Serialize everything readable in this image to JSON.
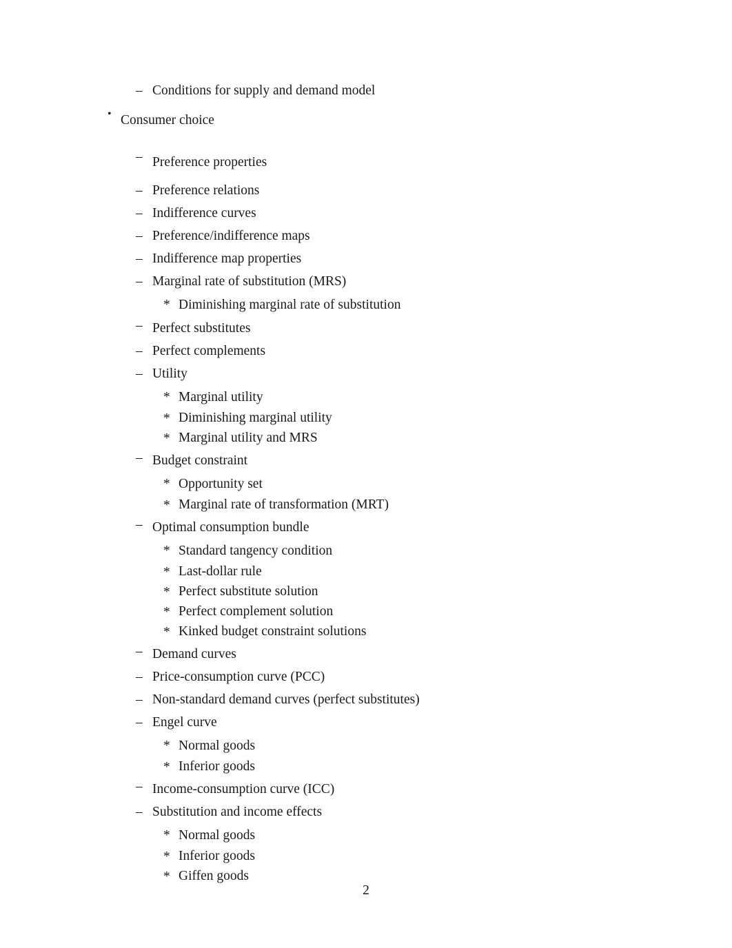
{
  "document": {
    "page_number": "2",
    "markers": {
      "level1": "•",
      "level2": "–",
      "level3": "*"
    }
  },
  "outline": [
    {
      "level": 2,
      "text": "Conditions for supply and demand model"
    },
    {
      "level": 1,
      "text": "Consumer choice"
    },
    {
      "level": 2,
      "text": "Preference properties"
    },
    {
      "level": 2,
      "text": "Preference relations"
    },
    {
      "level": 2,
      "text": "Indifference curves"
    },
    {
      "level": 2,
      "text": "Preference/indifference maps"
    },
    {
      "level": 2,
      "text": "Indifference map properties"
    },
    {
      "level": 2,
      "text": "Marginal rate of substitution (MRS)"
    },
    {
      "level": 3,
      "text": "Diminishing marginal rate of substitution"
    },
    {
      "level": 2,
      "text": "Perfect substitutes"
    },
    {
      "level": 2,
      "text": "Perfect complements"
    },
    {
      "level": 2,
      "text": "Utility"
    },
    {
      "level": 3,
      "text": "Marginal utility"
    },
    {
      "level": 3,
      "text": "Diminishing marginal utility"
    },
    {
      "level": 3,
      "text": "Marginal utility and MRS"
    },
    {
      "level": 2,
      "text": "Budget constraint"
    },
    {
      "level": 3,
      "text": "Opportunity set"
    },
    {
      "level": 3,
      "text": "Marginal rate of transformation (MRT)"
    },
    {
      "level": 2,
      "text": "Optimal consumption bundle"
    },
    {
      "level": 3,
      "text": "Standard tangency condition"
    },
    {
      "level": 3,
      "text": "Last-dollar rule"
    },
    {
      "level": 3,
      "text": "Perfect substitute solution"
    },
    {
      "level": 3,
      "text": "Perfect complement solution"
    },
    {
      "level": 3,
      "text": "Kinked budget constraint solutions"
    },
    {
      "level": 2,
      "text": "Demand curves"
    },
    {
      "level": 2,
      "text": "Price-consumption curve (PCC)"
    },
    {
      "level": 2,
      "text": "Non-standard demand curves (perfect substitutes)"
    },
    {
      "level": 2,
      "text": "Engel curve"
    },
    {
      "level": 3,
      "text": "Normal goods"
    },
    {
      "level": 3,
      "text": "Inferior goods"
    },
    {
      "level": 2,
      "text": "Income-consumption curve (ICC)"
    },
    {
      "level": 2,
      "text": "Substitution and income effects"
    },
    {
      "level": 3,
      "text": "Normal goods"
    },
    {
      "level": 3,
      "text": "Inferior goods"
    },
    {
      "level": 3,
      "text": "Giffen goods"
    }
  ]
}
